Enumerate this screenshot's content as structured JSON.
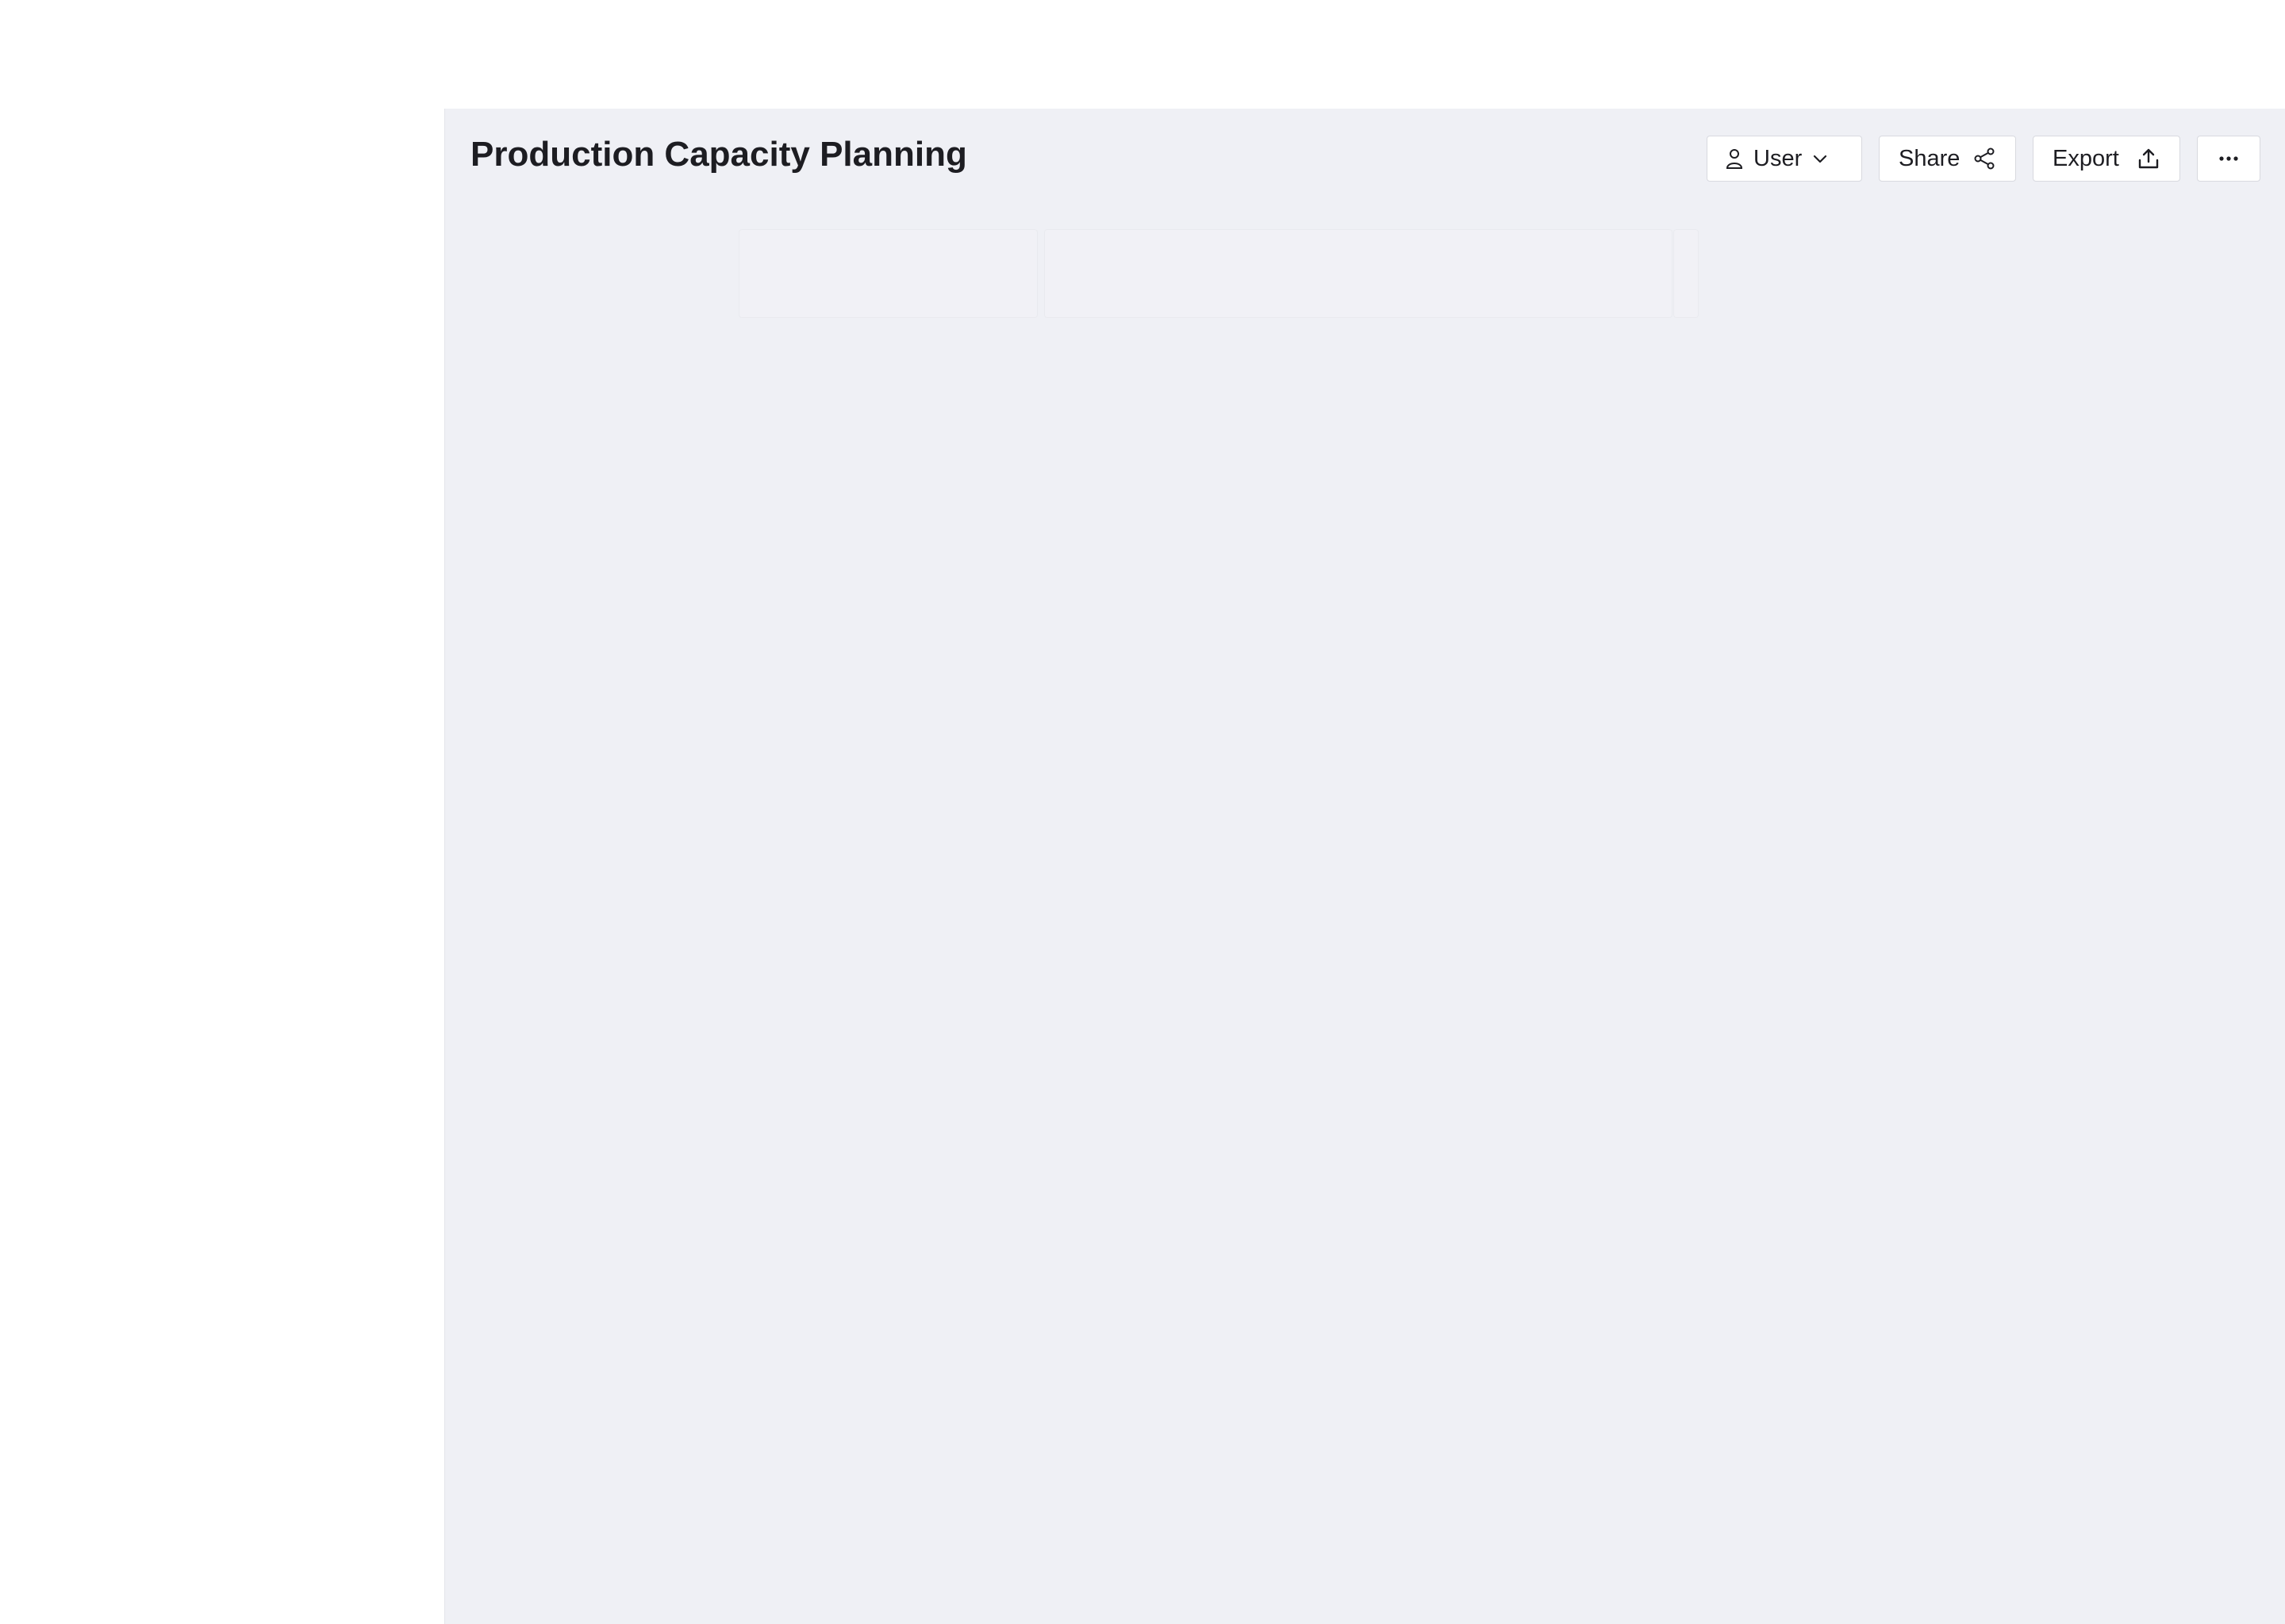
{
  "header": {
    "title": "Production Capacity Planning"
  },
  "toolbar": {
    "user_label": "User",
    "share_label": "Share",
    "export_label": "Export"
  },
  "icons": {
    "user": "user-icon",
    "chevron": "chevron-down-icon",
    "share": "share-icon",
    "export": "export-icon",
    "more": "more-icon"
  },
  "colors": {
    "panel_background": "#eff0f5",
    "text": "#1d1d22",
    "button_background": "#ffffff",
    "button_border": "#d8d9df"
  }
}
